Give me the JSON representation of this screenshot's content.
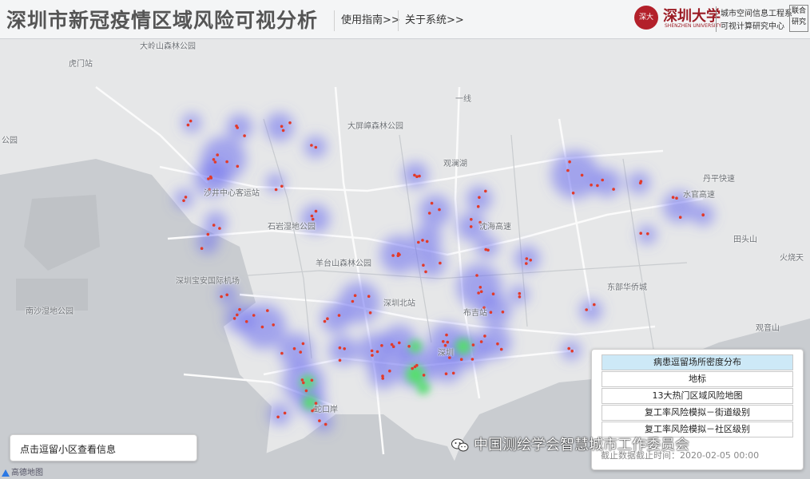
{
  "header": {
    "title": "深圳市新冠疫情区域风险可视分析",
    "nav": [
      "使用指南>>",
      "关于系统>>"
    ]
  },
  "logo": {
    "seal_text": "深大",
    "university_name": "深圳大学",
    "university_en": "SHENZHEN UNIVERSITY",
    "lab_line1": "城市空间信息工程系",
    "lab_line2": "可视计算研究中心",
    "joint_line1": "联合",
    "joint_line2": "研究"
  },
  "map": {
    "place_labels": [
      "大岭山森林公园",
      "虎门站",
      "公园",
      "大屏嶂森林公园",
      "观澜湖",
      "沙井中心客运站",
      "石岩湿地公园",
      "羊台山森林公园",
      "深圳宝安国际机场",
      "南沙湿地公园",
      "深圳北站",
      "布吉站",
      "东部华侨城",
      "深圳",
      "蛇口岸",
      "田头山",
      "火烧天",
      "观音山",
      "水官高速",
      "丹平快速",
      "沈海高速",
      "一线"
    ],
    "attribution": "高德地图"
  },
  "layers": {
    "items": [
      "病患逗留场所密度分布",
      "地标",
      "13大热门区域风险地图",
      "复工率风险模拟－街道级别",
      "复工率风险模拟－社区级别"
    ],
    "active_index": 0
  },
  "info": {
    "hint": "点击逗留小区查看信息"
  },
  "overlay": {
    "watermark": "中国测绘学会智慧城市工作委员会",
    "underlying_text": "截止数据截止时间：2020-02-05 00:00"
  },
  "colors": {
    "heat_low": "#6a6cf0",
    "heat_high": "#52e06a",
    "dot": "#e23a2a",
    "water": "#c9ccd0",
    "land": "#e6e7e8"
  }
}
